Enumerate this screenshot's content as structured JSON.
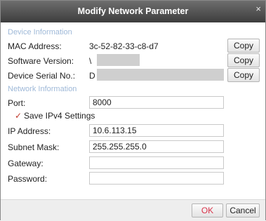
{
  "dialog": {
    "title": "Modify Network Parameter",
    "close_glyph": "×"
  },
  "device_info": {
    "section_label": "Device Information",
    "mac_label": "MAC Address:",
    "mac_value": "3c-52-82-33-c8-d7",
    "software_label": "Software Version:",
    "software_value": "\\",
    "serial_label": "Device Serial No.:",
    "serial_value": "D",
    "copy_label": "Copy"
  },
  "network_info": {
    "section_label": "Network Information",
    "port_label": "Port:",
    "port_value": "8000",
    "save_ipv4_label": "Save IPv4 Settings",
    "save_ipv4_checked": true,
    "ip_label": "IP Address:",
    "ip_value": "10.6.113.15",
    "subnet_label": "Subnet Mask:",
    "subnet_value": "255.255.255.0",
    "gateway_label": "Gateway:",
    "gateway_value": "",
    "password_label": "Password:",
    "password_value": ""
  },
  "footer": {
    "ok_label": "OK",
    "cancel_label": "Cancel"
  },
  "colors": {
    "titlebar": "#4a4a4a",
    "section": "#9fb9d8",
    "ok_text": "#d9334a",
    "check": "#c0392b"
  },
  "icons": {
    "close": "close-icon",
    "check": "checkmark-icon"
  }
}
